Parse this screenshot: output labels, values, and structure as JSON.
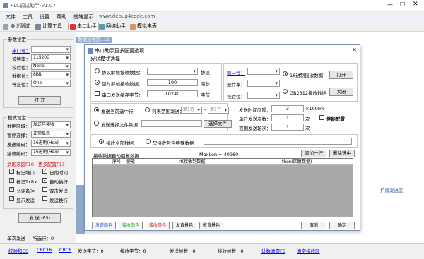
{
  "window": {
    "title": "PLC调试助手-V1.07"
  },
  "menu": [
    "文件",
    "工具",
    "设置",
    "帮助",
    "前端显示"
  ],
  "url": "www.debug4code.com",
  "toolbar": {
    "protocol": "协议测试",
    "calc": "计算工具",
    "serial": "串口助手",
    "net": "网络助手",
    "sim": "模拟电表"
  },
  "left": {
    "params_title": "参数设定",
    "port_label": "串口号：",
    "baud_label": "波特率：",
    "baud_val": "115200",
    "parity_label": "校验位：",
    "parity_val": "None",
    "data_label": "数据位：",
    "data_val": "8Bit",
    "stop_label": "停止位：",
    "stop_val": "One",
    "open_btn": "打 开",
    "mode_title": "模式设定",
    "show_area_label": "数据区域：",
    "show_area_val": "发送与接收",
    "pause_label": "暂停选择：",
    "pause_val": "正常显示",
    "send_code_label": "发送编码：",
    "send_code_val": "16进制(Hex)",
    "recv_code_label": "接收编码：",
    "recv_code_val": "16进制(Hex)",
    "clear_link": "消影滚区F10",
    "more_link": "更多配置F11",
    "cb_mark_port": "标记端口",
    "cb_date": "日期时间",
    "cb_mark_txrx": "标记TxRx",
    "cb_autowrap": "自动换行",
    "cb_allow_note": "允许备注",
    "cb_double_click": "双击发送",
    "cb_show_send": "显示发送",
    "cb_send_wrap": "发送换行",
    "send_btn": "发 送 (F5)",
    "single_send": "单次发送",
    "line_count": "所选行：0",
    "checksum": "校验和CS",
    "crc16": "CRC16",
    "crc8": "CRC8"
  },
  "recv_area": {
    "title": "数据接收区111",
    "expand": "扩展发送区"
  },
  "dialog": {
    "title": "串口助手更多配置选项",
    "send_mode": "发送模式选择",
    "opt_protocol": "协议解帧接收数据：",
    "protocol_unit": "协议",
    "opt_timeout": "超时解帧接收数据：",
    "timeout_val": "100",
    "timeout_unit": "毫秒",
    "opt_buffer": "串口发送缓存字节：",
    "buffer_val": "10240",
    "buffer_unit": "字节",
    "port_label": "端口号：",
    "baud_label": "波特率：",
    "parity_label": "校验位：",
    "hex_recv": "16进制接收数据",
    "gb_recv": "GB2312接收数据",
    "open_btn": "打开",
    "close_btn": "关闭",
    "send_current": "发送当前选中行",
    "send_list": "列表范围发送：",
    "row_a": "第1行",
    "row_b": "第1行",
    "send_file": "发送选择文件数据：",
    "choose_file": "选择文件",
    "interval_label": "发送时间间隔：",
    "interval_val": "3",
    "interval_unit": "×100ms",
    "single_count_label": "单行发送次数：",
    "single_count_val": "1",
    "count_unit": "次",
    "range_count_label": "范围发送轮次：",
    "range_count_val": "1",
    "range_unit": "次",
    "enable_cfg": "使能配置",
    "recv_all": "接收全部数据",
    "recv_special": "只接收包含特殊数据",
    "auto_reply": "接收数据自动回复数据",
    "maxlen": "MaxLen = 40960",
    "add_row": "添加一行",
    "del_row": "删除选中",
    "columns": [
      "序号",
      "使能",
      "rt(接收到数据)",
      "then(回复数据)"
    ],
    "btn_send_color": "发送颜色",
    "btn_recv_color": "接收颜色",
    "btn_recv_color2": "接收颜色",
    "btn_send_bg": "发背景色",
    "btn_recv_bg": "收背景色",
    "cancel": "取消",
    "ok": "确定"
  },
  "status": {
    "send_bytes": "发送字节：0",
    "recv_bytes": "接收字节：0",
    "send_frames": "发送帧数：0",
    "recv_frames": "接收帧数：0",
    "clear_count": "计数清零F6",
    "clear_send": "清空接收区"
  }
}
